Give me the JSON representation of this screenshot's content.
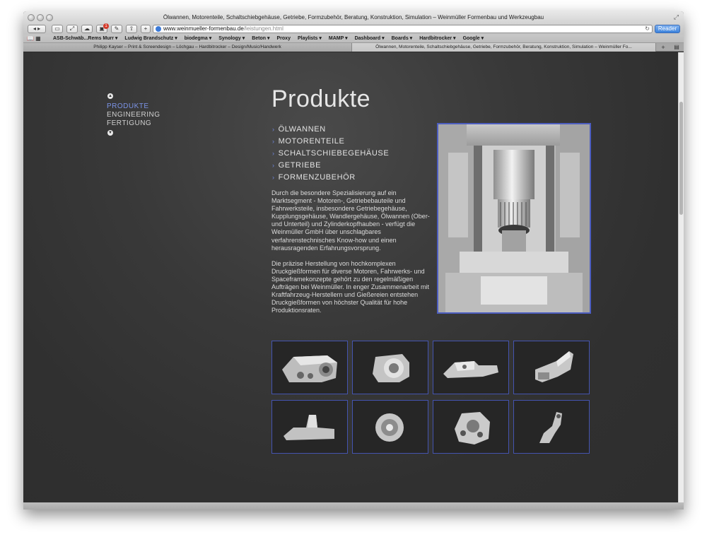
{
  "window": {
    "title": "Ölwannen, Motorenteile, Schaltschiebgehäuse, Getriebe, Formzubehör, Beratung, Konstruktion, Simulation – Weinmüller Formenbau und Werkzeugbau"
  },
  "toolbar": {
    "url_host": "www.weinmueller-formenbau.de",
    "url_path": "/leistungen.html",
    "reader_label": "Reader",
    "badge_count": "1"
  },
  "bookmarks": [
    "ASB-Schwäb...Rems Murr ▾",
    "Ludwig Brandschutz ▾",
    "biodegma ▾",
    "Synology ▾",
    "Beton ▾",
    "Proxy",
    "Playlists ▾",
    "MAMP ▾",
    "Dashboard ▾",
    "Boards ▾",
    "Hardbitrocker ▾",
    "Google ▾"
  ],
  "tabs": [
    {
      "label": "Philipp Kayser – Print & Screendesign – Löchgau – Hardbitrocker – Design/Music/Handwerk",
      "active": false
    },
    {
      "label": "Ölwannen, Motorenteile, Schaltschiebgehäuse, Getriebe, Formzubehör, Beratung, Konstruktion, Simulation – Weinmüller Fo...",
      "active": true
    }
  ],
  "sidenav": {
    "items": [
      {
        "label": "PRODUKTE",
        "active": true
      },
      {
        "label": "ENGINEERING",
        "active": false
      },
      {
        "label": "FERTIGUNG",
        "active": false
      }
    ]
  },
  "page": {
    "title": "Produkte",
    "categories": [
      "ÖLWANNEN",
      "MOTORENTEILE",
      "SCHALTSCHIEBEGEHÄUSE",
      "GETRIEBE",
      "FORMENZUBEHÖR"
    ],
    "paragraphs": [
      "Durch die besondere Spezialisierung auf ein Marktsegment - Motoren-, Getriebebauteile und Fahrwerksteile, insbesondere Getriebegehäuse, Kupplungsgehäuse, Wandlergehäuse, Ölwannen (Ober- und Unterteil) und Zylinderkopfhauben - verfügt die Weinmüller GmbH über unschlagbares verfahrenstechnisches Know-how und einen herausragenden Erfahrungsvorsprung.",
      "Die präzise Herstellung von hochkomplexen Druckgießformen für diverse Motoren, Fahrwerks- und Spaceframekonzepte gehört zu den regelmäßigen Aufträgen bei Weinmüller. In enger Zusammenarbeit mit Kraftfahrzeug-Herstellern und Gießereien entstehen Druckgießformen von höchster Qualität für hohe Produktionsraten."
    ]
  },
  "colors": {
    "accent": "#6f86d8",
    "thumb_border": "#4454b0",
    "background": "#333333"
  }
}
